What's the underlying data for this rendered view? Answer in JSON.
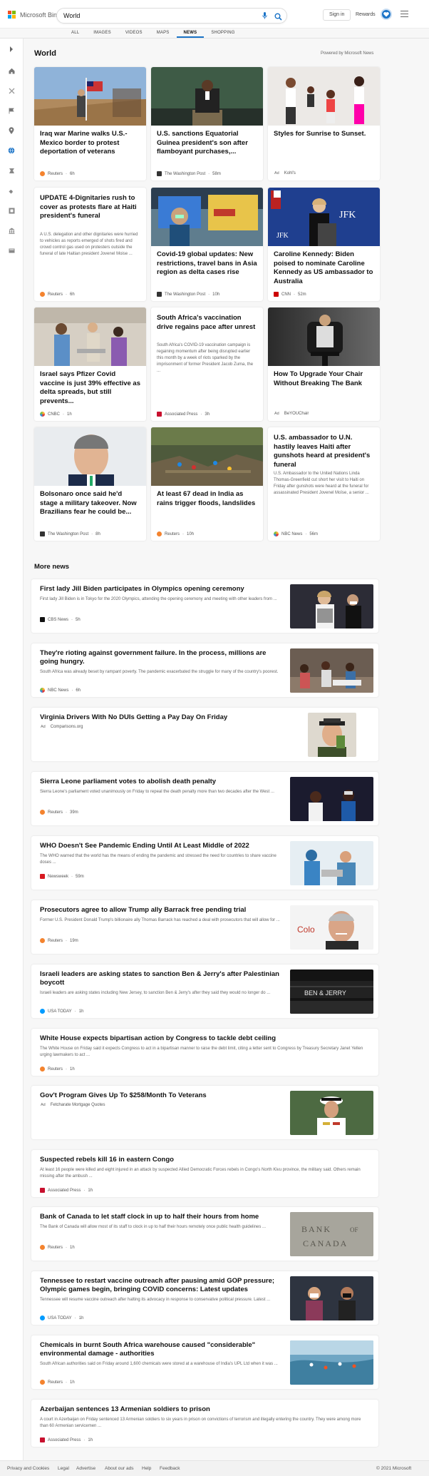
{
  "header": {
    "logo_text": "Microsoft Bing",
    "search_value": "World",
    "signin_label": "Sign in",
    "rewards_label": "Rewards",
    "accent_color": "#1a73c7"
  },
  "tabs": [
    "ALL",
    "IMAGES",
    "VIDEOS",
    "MAPS",
    "NEWS",
    "SHOPPING"
  ],
  "active_tab": "NEWS",
  "sidebar_icons": [
    "expand-arrow-icon",
    "home-icon",
    "trending-icon",
    "flag-icon",
    "location-pin-icon",
    "globe-icon",
    "science-icon",
    "sports-icon",
    "entertainment-icon",
    "business-icon",
    "politics-icon"
  ],
  "world": {
    "title": "World",
    "powered_by": "Powered by Microsoft News",
    "cards": [
      {
        "title": "Iraq war Marine walks U.S.-Mexico border to protest deportation of veterans",
        "source": "Reuters",
        "time": "6h"
      },
      {
        "title": "U.S. sanctions Equatorial Guinea president's son after flamboyant purchases,...",
        "source": "The Washington Post",
        "time": "58m"
      },
      {
        "title": "Styles for Sunrise to Sunset.",
        "ad": "Ad",
        "source": "Kohl's",
        "time": ""
      },
      {
        "title": "UPDATE 4-Dignitaries rush to cover as protests flare at Haiti president's funeral",
        "snippet": "A U.S. delegation and other dignitaries were hurried to vehicles as reports emerged of shots fired and crowd control gas used on protesters outside the funeral of late Haitian president Jovenel Moise ...",
        "source": "Reuters",
        "time": "6h"
      },
      {
        "title": "Covid-19 global updates: New restrictions, travel bans in Asia region as delta cases rise",
        "source": "The Washington Post",
        "time": "10h"
      },
      {
        "title": "Caroline Kennedy: Biden poised to nominate Caroline Kennedy as US ambassador to Australia",
        "source": "CNN",
        "time": "52m"
      },
      {
        "title": "Israel says Pfizer Covid vaccine is just 39% effective as delta spreads, but still prevents...",
        "source": "CNBC",
        "time": "1h"
      },
      {
        "title": "South Africa's vaccination drive regains pace after unrest",
        "snippet": "South Africa's COVID-19 vaccination campaign is regaining momentum after being disrupted earlier this month by a week of riots sparked by the imprisonment of former President Jacob Zuma, the ...",
        "source": "Associated Press",
        "time": "3h"
      },
      {
        "title": "How To Upgrade Your Chair Without Breaking The Bank",
        "ad": "Ad",
        "source": "BeYOUChair",
        "time": ""
      },
      {
        "title": "Bolsonaro once said he'd stage a military takeover. Now Brazilians fear he could be...",
        "source": "The Washington Post",
        "time": "8h"
      },
      {
        "title": "At least 67 dead in India as rains trigger floods, landslides",
        "source": "Reuters",
        "time": "10h"
      },
      {
        "title": "U.S. ambassador to U.N. hastily leaves Haiti after gunshots heard at president's funeral",
        "snippet": "U.S. Ambassador to the United Nations Linda Thomas-Greenfield cut short her visit to Haiti on Friday after gunshots were heard at the funeral for assassinated President Jovenel Moïse, a senior ...",
        "source": "NBC News",
        "time": "56m"
      }
    ]
  },
  "more_news": {
    "title": "More news",
    "items": [
      {
        "title": "First lady Jill Biden participates in Olympics opening ceremony",
        "snippet": "First lady Jill Biden is in Tokyo for the 2020 Olympics, attending the opening ceremony and meeting with other leaders from ...",
        "source": "CBS News",
        "time": "5h"
      },
      {
        "title": "They're rioting against government failure. In the process, millions are going hungry.",
        "snippet": "South Africa was already beset by rampant poverty. The pandemic exacerbated the struggle for many of the country's poorest.",
        "source": "NBC News",
        "time": "6h"
      },
      {
        "title": "Virginia Drivers With No DUIs Getting a Pay Day On Friday",
        "snippet": "",
        "ad": "Ad",
        "source": "Comparisons.org",
        "time": ""
      },
      {
        "title": "Sierra Leone parliament votes to abolish death penalty",
        "snippet": "Sierra Leone's parliament voted unanimously on Friday to repeal the death penalty more than two decades after the West ...",
        "source": "Reuters",
        "time": "39m"
      },
      {
        "title": "WHO Doesn't See Pandemic Ending Until At Least Middle of 2022",
        "snippet": "The WHO warned that the world has the means of ending the pandemic and stressed the need for countries to share vaccine doses ...",
        "source": "Newsweek",
        "time": "59m"
      },
      {
        "title": "Prosecutors agree to allow Trump ally Barrack free pending trial",
        "snippet": "Former U.S. President Donald Trump's billionaire ally Thomas Barrack has reached a deal with prosecutors that will allow for ...",
        "source": "Reuters",
        "time": "19m"
      },
      {
        "title": "Israeli leaders are asking states to sanction Ben & Jerry's after Palestinian boycott",
        "snippet": "Israeli leaders are asking states including New Jersey, to sanction Ben & Jerry's after they said they would no longer do ...",
        "source": "USA TODAY",
        "time": "1h"
      },
      {
        "title": "White House expects bipartisan action by Congress to tackle debt ceiling",
        "snippet": "The White House on Friday said it expects Congress to act in a bipartisan manner to raise the debt limit, citing a letter sent to Congress by Treasury Secretary Janet Yellen urging lawmakers to act ...",
        "source": "Reuters",
        "time": "1h"
      },
      {
        "title": "Gov't Program Gives Up To $258/Month To Veterans",
        "snippet": "",
        "ad": "Ad",
        "source": "Fetcharate Mortgage Quotes",
        "time": ""
      },
      {
        "title": "Suspected rebels kill 16 in eastern Congo",
        "snippet": "At least 16 people were killed and eight injured in an attack by suspected Allied Democratic Forces rebels in Congo's North Kivu province, the military said. Others remain missing after the ambush ...",
        "source": "Associated Press",
        "time": "1h"
      },
      {
        "title": "Bank of Canada to let staff clock in up to half their hours from home",
        "snippet": "The Bank of Canada will allow most of its staff to clock in up to half their hours remotely once public health guidelines ...",
        "source": "Reuters",
        "time": "1h"
      },
      {
        "title": "Tennessee to restart vaccine outreach after pausing amid GOP pressure; Olympic games begin, bringing COVID concerns: Latest updates",
        "snippet": "Tennessee will resume vaccine outreach after halting its advocacy in response to conservative political pressure. Latest ...",
        "source": "USA TODAY",
        "time": "1h"
      },
      {
        "title": "Chemicals in burnt South Africa warehouse caused \"considerable\" environmental damage - authorities",
        "snippet": "South African authorities said on Friday around 1,600 chemicals were stored at a warehouse of India's UPL Ltd when it was ...",
        "source": "Reuters",
        "time": "1h"
      },
      {
        "title": "Azerbaijan sentences 13 Armenian soldiers to prison",
        "snippet": "A court in Azerbaijan on Friday sentenced 13 Armenian soldiers to six years in prison on convictions of terrorism and illegally entering the country. They were among more than 60 Armenian servicemen ...",
        "source": "Associated Press",
        "time": "1h"
      }
    ]
  },
  "footer": {
    "links": [
      "Privacy and Cookies",
      "Legal",
      "Advertise",
      "About our ads",
      "Help",
      "Feedback"
    ],
    "copyright": "© 2021 Microsoft"
  }
}
